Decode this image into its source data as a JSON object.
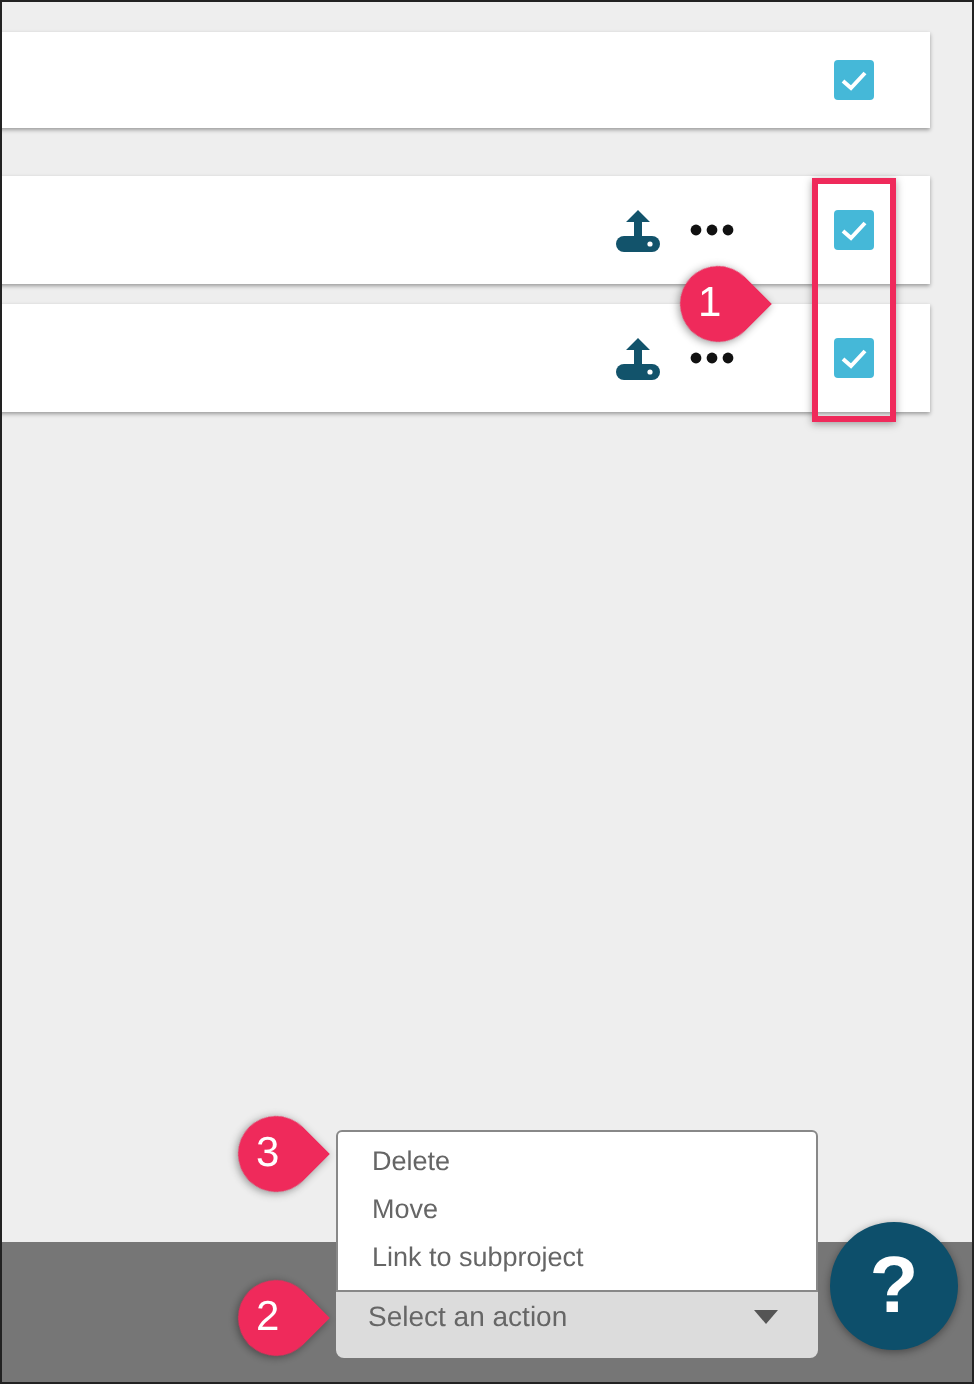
{
  "rows": [
    {
      "kind": "plain",
      "checked": true
    },
    {
      "kind": "actions",
      "checked": true
    },
    {
      "kind": "actions",
      "checked": true
    }
  ],
  "highlight": {
    "number": "1"
  },
  "action_menu": {
    "expanded": true,
    "menu_callout": "3",
    "placeholder": "Select an action",
    "select_callout": "2",
    "options": [
      "Delete",
      "Move",
      "Link to subproject"
    ]
  },
  "help_button": {
    "label": "?"
  }
}
